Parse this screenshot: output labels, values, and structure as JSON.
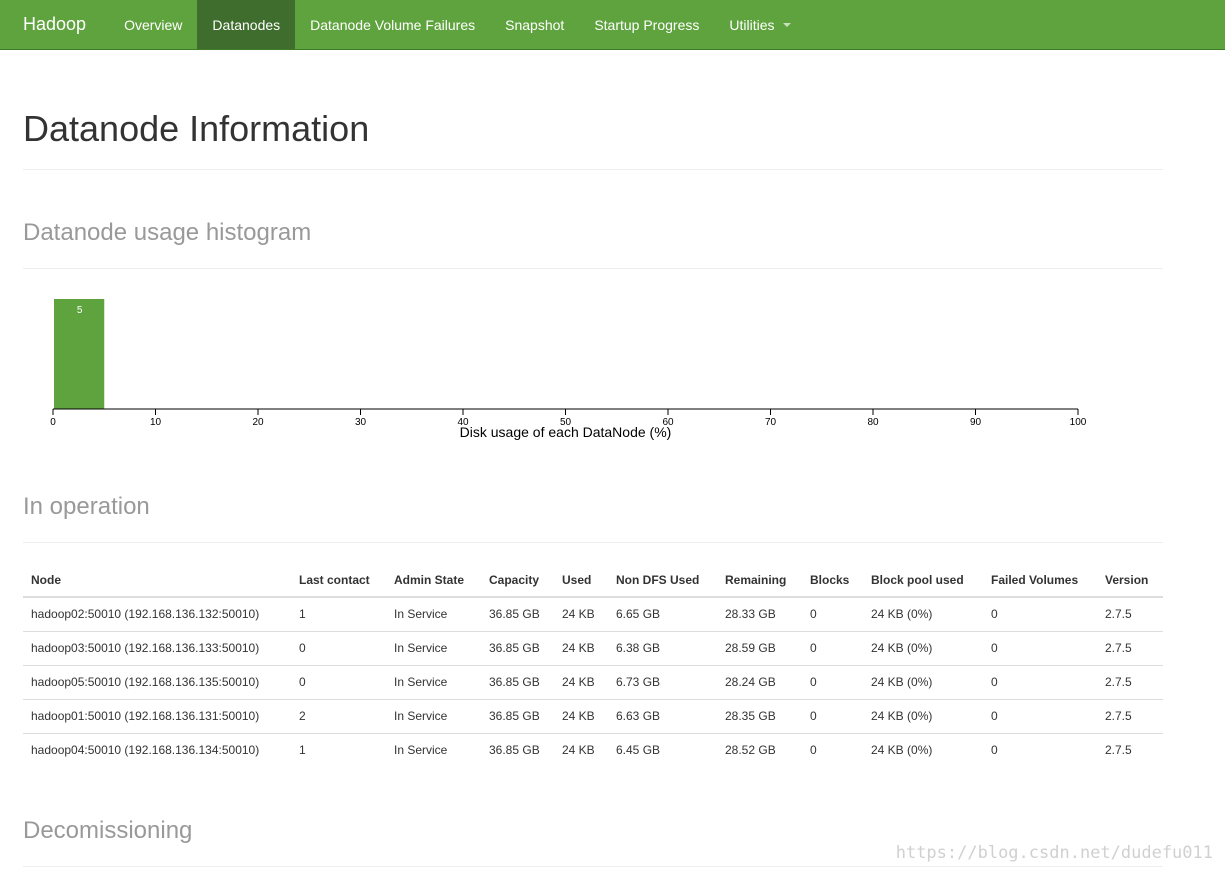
{
  "navbar": {
    "brand": "Hadoop",
    "items": [
      {
        "label": "Overview",
        "active": false
      },
      {
        "label": "Datanodes",
        "active": true
      },
      {
        "label": "Datanode Volume Failures",
        "active": false
      },
      {
        "label": "Snapshot",
        "active": false
      },
      {
        "label": "Startup Progress",
        "active": false
      },
      {
        "label": "Utilities",
        "active": false,
        "dropdown": true
      }
    ]
  },
  "page": {
    "title": "Datanode Information"
  },
  "sections": {
    "histogram": "Datanode usage histogram",
    "in_operation": "In operation",
    "decommissioning": "Decomissioning"
  },
  "chart_data": {
    "type": "bar",
    "bins": [
      {
        "x0": 0,
        "x1": 5,
        "count": 5
      }
    ],
    "xlabel": "Disk usage of each DataNode (%)",
    "xlim": [
      0,
      100
    ],
    "xticks": [
      0,
      10,
      20,
      30,
      40,
      50,
      60,
      70,
      80,
      90,
      100
    ],
    "bar_color": "#5fa33e",
    "grid": false
  },
  "table": {
    "columns": [
      "Node",
      "Last contact",
      "Admin State",
      "Capacity",
      "Used",
      "Non DFS Used",
      "Remaining",
      "Blocks",
      "Block pool used",
      "Failed Volumes",
      "Version"
    ],
    "rows": [
      [
        "hadoop02:50010 (192.168.136.132:50010)",
        "1",
        "In Service",
        "36.85 GB",
        "24 KB",
        "6.65 GB",
        "28.33 GB",
        "0",
        "24 KB (0%)",
        "0",
        "2.7.5"
      ],
      [
        "hadoop03:50010 (192.168.136.133:50010)",
        "0",
        "In Service",
        "36.85 GB",
        "24 KB",
        "6.38 GB",
        "28.59 GB",
        "0",
        "24 KB (0%)",
        "0",
        "2.7.5"
      ],
      [
        "hadoop05:50010 (192.168.136.135:50010)",
        "0",
        "In Service",
        "36.85 GB",
        "24 KB",
        "6.73 GB",
        "28.24 GB",
        "0",
        "24 KB (0%)",
        "0",
        "2.7.5"
      ],
      [
        "hadoop01:50010 (192.168.136.131:50010)",
        "2",
        "In Service",
        "36.85 GB",
        "24 KB",
        "6.63 GB",
        "28.35 GB",
        "0",
        "24 KB (0%)",
        "0",
        "2.7.5"
      ],
      [
        "hadoop04:50010 (192.168.136.134:50010)",
        "1",
        "In Service",
        "36.85 GB",
        "24 KB",
        "6.45 GB",
        "28.52 GB",
        "0",
        "24 KB (0%)",
        "0",
        "2.7.5"
      ]
    ]
  },
  "watermark": "https://blog.csdn.net/dudefu011"
}
